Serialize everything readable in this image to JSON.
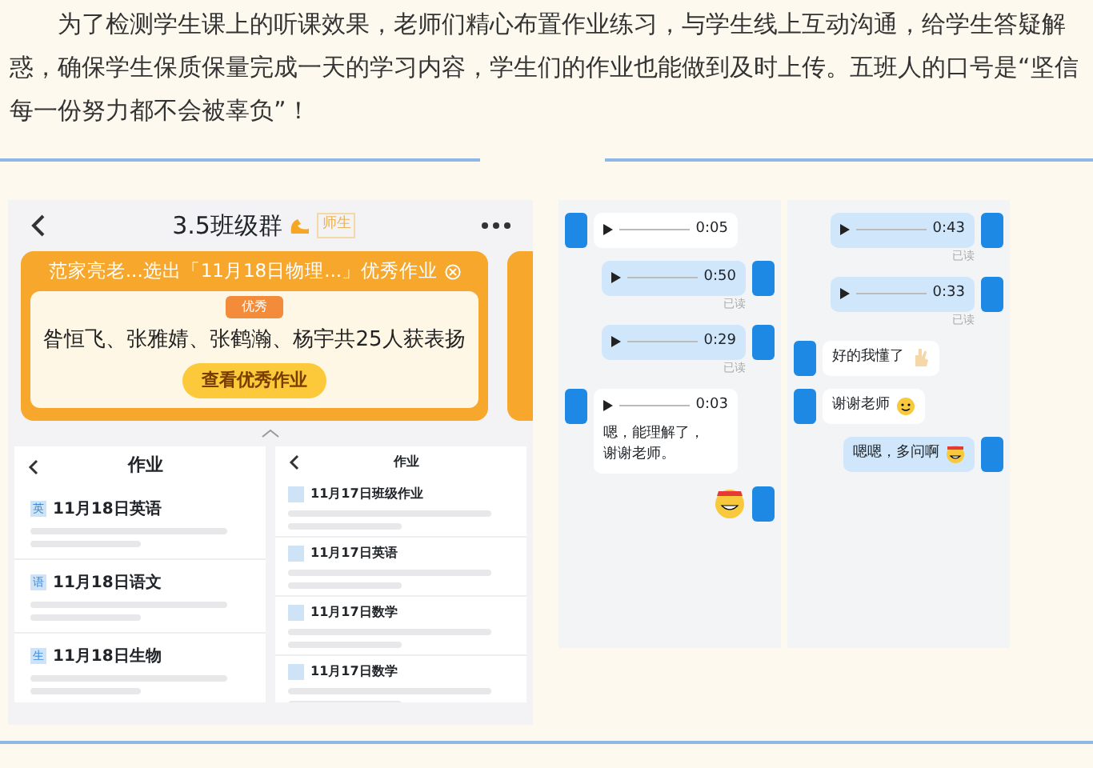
{
  "article": {
    "paragraph": "为了检测学生课上的听课效果，老师们精心布置作业练习，与学生线上互动沟通，给学生答疑解惑，确保学生保质保量完成一天的学习内容，学生们的作业也能做到及时上传。五班人的口号是“坚信每一份努力都不会被辜负”！"
  },
  "group_screenshot": {
    "title": "3.5班级群",
    "tag": "师生",
    "notice": "范家亮老...选出「11月18日物理...」优秀作业",
    "medal": "优秀",
    "praise": "昝恒飞、张雅婧、张鹤瀚、杨宇共25人获表扬",
    "button": "查看优秀作业"
  },
  "homework_panes": [
    {
      "title": "作业",
      "items": [
        {
          "tag": "英",
          "title": "11月18日英语"
        },
        {
          "tag": "语",
          "title": "11月18日语文"
        },
        {
          "tag": "生",
          "title": "11月18日生物"
        }
      ]
    },
    {
      "title": "作业",
      "items": [
        {
          "title": "11月17日班级作业"
        },
        {
          "title": "11月17日英语"
        },
        {
          "title": "11月17日数学"
        },
        {
          "title": "11月17日数学"
        }
      ]
    }
  ],
  "chat_panes": [
    {
      "messages": [
        {
          "kind": "voice",
          "outgoing": false,
          "duration": "0:05"
        },
        {
          "kind": "voice",
          "outgoing": true,
          "duration": "0:50",
          "status": "已读"
        },
        {
          "kind": "voice",
          "outgoing": true,
          "duration": "0:29",
          "status": "已读"
        },
        {
          "kind": "voice",
          "outgoing": false,
          "duration": "0:03",
          "text": "嗯，能理解了，谢谢老师。"
        },
        {
          "kind": "sticker",
          "outgoing": true
        }
      ]
    },
    {
      "messages": [
        {
          "kind": "voice",
          "outgoing": true,
          "duration": "0:43",
          "status": "已读"
        },
        {
          "kind": "voice",
          "outgoing": true,
          "duration": "0:33",
          "status": "已读"
        },
        {
          "kind": "text",
          "outgoing": false,
          "text": "好的我懂了",
          "emoji": {
            "kind": "hand"
          }
        },
        {
          "kind": "text",
          "outgoing": false,
          "text": "谢谢老师",
          "emoji": {
            "kind": "smile"
          }
        },
        {
          "kind": "text",
          "outgoing": true,
          "text": "嗯嗯，多问啊",
          "emoji": {
            "kind": "grin"
          }
        }
      ]
    }
  ]
}
